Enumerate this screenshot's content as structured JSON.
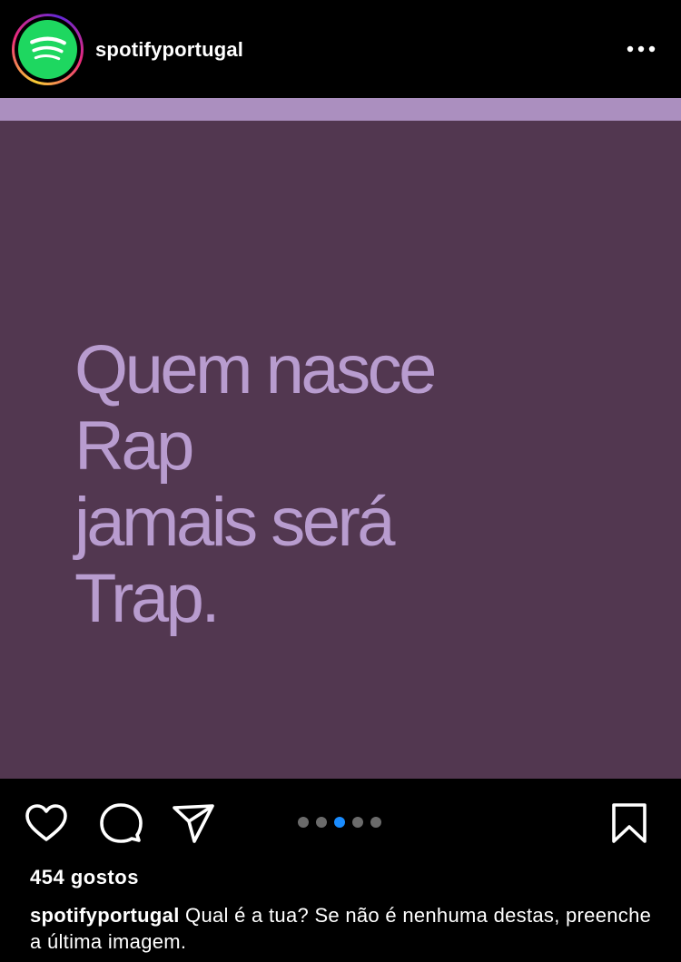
{
  "header": {
    "username": "spotifyportugal",
    "avatar_icon": "spotify-logo-icon",
    "more_icon": "more-options-icon"
  },
  "post": {
    "lines": [
      "Quem nasce",
      "Rap",
      "jamais será",
      "Trap."
    ],
    "background_color": "#523750",
    "strip_color": "#ab8fbf",
    "text_color": "#b89ccf"
  },
  "actions": {
    "like_icon": "heart-icon",
    "comment_icon": "comment-icon",
    "share_icon": "send-icon",
    "save_icon": "bookmark-icon",
    "carousel": {
      "total": 5,
      "active_index": 2,
      "active_color": "#1a8cff",
      "inactive_color": "#6b6b6b"
    }
  },
  "likes": "454 gostos",
  "caption": {
    "username": "spotifyportugal",
    "text": "Qual é a tua? Se não é nenhuma destas, preenche a última imagem."
  }
}
